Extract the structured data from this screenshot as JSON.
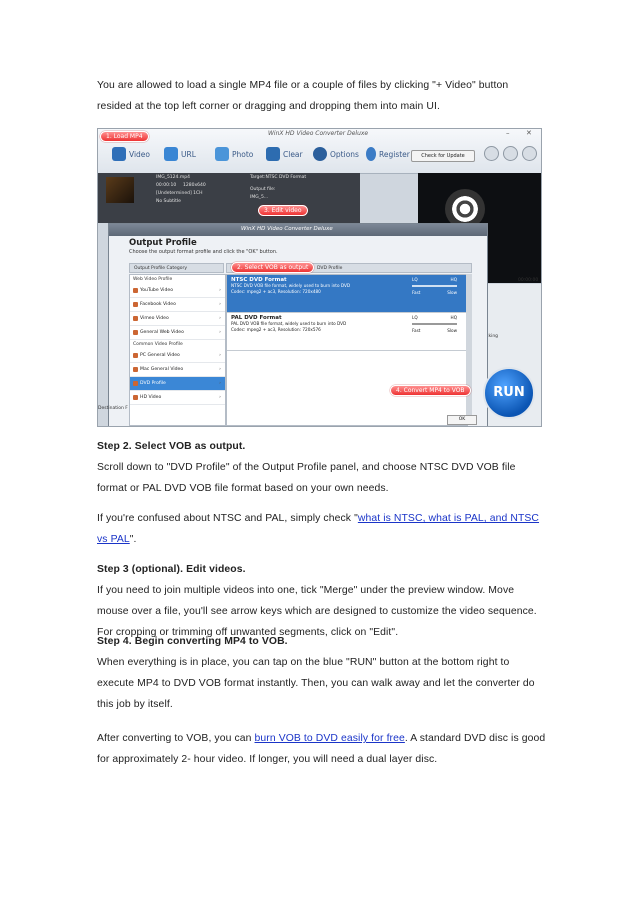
{
  "intro": {
    "line1": "You are allowed to load a single MP4 file or a couple of files by clicking \"+ Video\" button",
    "line2": "resided at the top left corner or dragging and dropping them into main UI."
  },
  "screenshot": {
    "window_title": "WinX HD Video Converter Deluxe",
    "toolbar": {
      "video": "Video",
      "url": "URL",
      "photo": "Photo",
      "clear": "Clear",
      "options": "Options",
      "register": "Register",
      "check_update": "Check for Update"
    },
    "callouts": {
      "load": "1. Load MP4",
      "edit": "3. Edit video",
      "select": "2. Select VOB as output",
      "convert": "4. Convert MP4 to VOB"
    },
    "file_info": {
      "name": "IMG_5124.mp4",
      "duration": "00:00:10",
      "resolution": "1280x640",
      "audio": "[Undetermined] 1CH",
      "subtitle": "No Subtitle",
      "target": "Target:NTSC DVD Format",
      "output_file": "Output file:",
      "output_name": "IMG_5..."
    },
    "dialog": {
      "title": "WinX HD Video Converter Deluxe",
      "heading": "Output Profile",
      "subtitle": "Choose the output format profile and click the \"OK\" button.",
      "col_category": "Output Profile Category",
      "col_profile": "DVD Profile",
      "group_web": "Web Video Profile",
      "group_common": "Common Video Profile",
      "categories_web": [
        "YouTube Video",
        "Facebook Video",
        "Vimeo Video",
        "General Web Video"
      ],
      "categories_common": [
        "PC General Video",
        "Mac General Video",
        "DVD Profile",
        "HD Video"
      ],
      "formats": [
        {
          "name": "NTSC DVD Format",
          "desc1": "NTSC DVD VOB file format, widely used to burn into DVD",
          "desc2": "Codec: mpeg2 + ac3, Resolution: 720x480"
        },
        {
          "name": "PAL DVD Format",
          "desc1": "PAL DVD VOB file format, widely used to burn into DVD",
          "desc2": "Codec: mpeg2 + ac3, Resolution: 720x576"
        }
      ],
      "lq": "LQ",
      "hq": "HQ",
      "fast": "Fast",
      "slow": "Slow",
      "ok": "OK"
    },
    "run": "RUN",
    "destination": "Destination F",
    "time": "00:00:00",
    "side_text": "cking"
  },
  "step2": {
    "heading": "Step 2. Select VOB as output.",
    "line1": "Scroll down to \"DVD Profile\" of the Output Profile panel, and choose NTSC DVD VOB file",
    "line2": "format or PAL DVD VOB file format based on your own needs."
  },
  "ntsc": {
    "pre": "If you're confused about NTSC and PAL, simply check \"",
    "link_part1": "what is NTSC, what is PAL, and NTSC",
    "link_part2": "vs PAL",
    "post": "\"."
  },
  "step3": {
    "heading": "Step 3 (optional). Edit videos.",
    "line1": "If you need to join multiple videos into one, tick \"Merge\" under the preview window. Move",
    "line2": "mouse over a file, you'll see arrow keys which are designed to customize the video sequence.",
    "line3": "For cropping or trimming off unwanted segments, click on \"Edit\"."
  },
  "step4": {
    "heading": "Step 4. Begin converting MP4 to VOB.",
    "line1": "When everything is in place, you can tap on the blue \"RUN\" button at the bottom right to",
    "line2": "execute MP4 to DVD VOB format instantly. Then, you can walk away and let the converter do",
    "line3": "this job by itself."
  },
  "after": {
    "pre": "After converting to VOB, you can ",
    "link": "burn VOB to DVD easily for free",
    "post": ". A standard DVD disc is good",
    "line2": "for approximately 2- hour video. If longer, you will need a dual layer disc."
  },
  "colors": {
    "link": "#1a34c8",
    "callout": "#e33333",
    "run": "#0b55b3"
  }
}
